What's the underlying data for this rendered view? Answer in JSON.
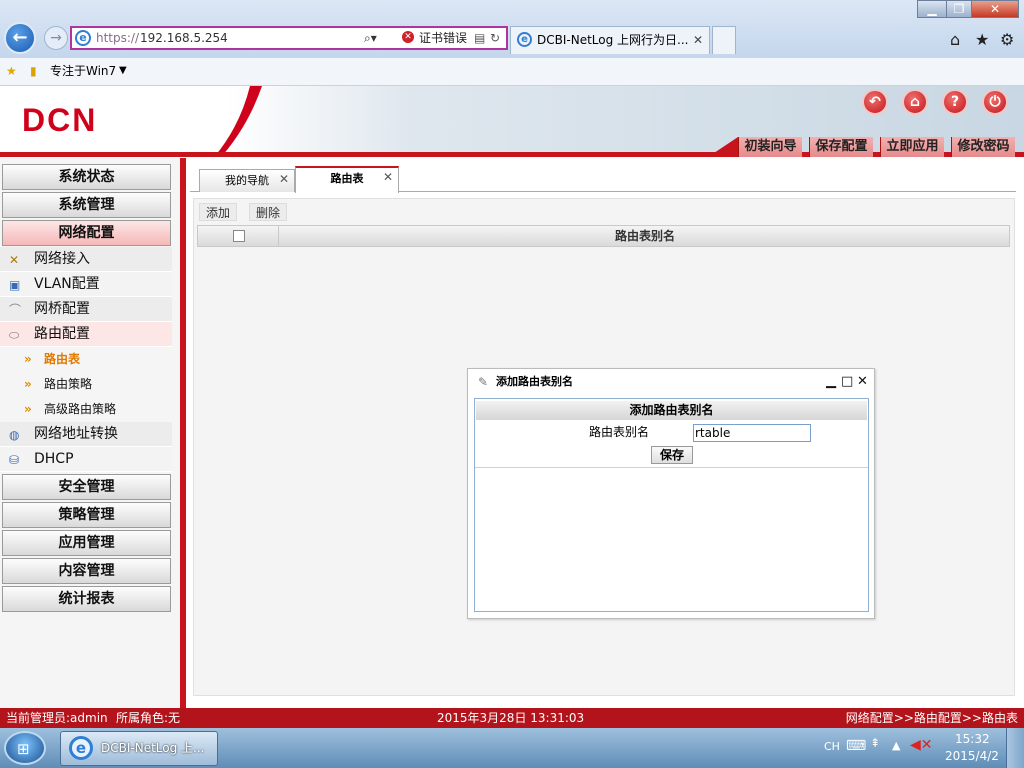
{
  "browser": {
    "address_prefix": "https://",
    "address_host": "192.168.5.254",
    "cert_error": "证书错误",
    "tab_title": "DCBI-NetLog 上网行为日...",
    "fav_label": "专注于Win7"
  },
  "app": {
    "logo": "DCN",
    "top_links": [
      "初装向导",
      "保存配置",
      "立即应用",
      "修改密码"
    ]
  },
  "sidebar": {
    "top_groups": [
      "系统状态",
      "系统管理",
      "网络配置"
    ],
    "network_items": [
      "网络接入",
      "VLAN配置",
      "网桥配置",
      "路由配置"
    ],
    "route_items": [
      "路由表",
      "路由策略",
      "高级路由策略"
    ],
    "more_items": [
      "网络地址转换",
      "DHCP"
    ],
    "bottom_groups": [
      "安全管理",
      "策略管理",
      "应用管理",
      "内容管理",
      "统计报表"
    ]
  },
  "main": {
    "tabs": [
      "我的导航",
      "路由表"
    ],
    "toolbar": {
      "add": "添加",
      "delete": "删除"
    },
    "table": {
      "column": "路由表别名"
    }
  },
  "dialog": {
    "title": "添加路由表别名",
    "form_header": "添加路由表别名",
    "field_label": "路由表别名",
    "field_value": "rtable",
    "save": "保存"
  },
  "status": {
    "admin": "当前管理员:admin",
    "role": "所属角色:无",
    "datetime": "2015年3月28日 13:31:03",
    "breadcrumb": "网络配置>>路由配置>>路由表"
  },
  "taskbar": {
    "task": "DCBI-NetLog 上...",
    "ime": "CH",
    "time": "15:32",
    "date": "2015/4/2"
  }
}
